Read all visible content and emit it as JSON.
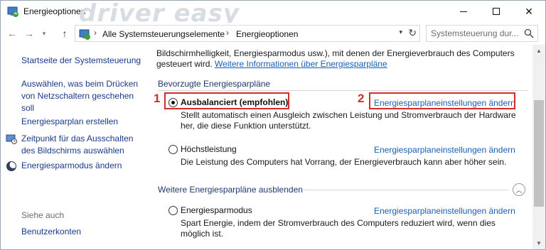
{
  "window": {
    "title": "Energieoptionen",
    "watermark": "driver easy",
    "watermark_url": "www.DriverEasy.com"
  },
  "navbar": {
    "back_glyph": "←",
    "forward_glyph": "→",
    "up_glyph": "↑",
    "breadcrumbs": [
      "Alle Systemsteuerungselemente",
      "Energieoptionen"
    ],
    "breadcrumb_separator": "›",
    "search_placeholder": "Systemsteuerung dur..."
  },
  "sidebar": {
    "home": "Startseite der Systemsteuerung",
    "link_power_buttons": "Auswählen, was beim Drücken von Netzschaltern geschehen soll",
    "link_create_plan": "Energiesparplan erstellen",
    "link_display_off": "Zeitpunkt für das Ausschalten des Bildschirms auswählen",
    "link_sleep": "Energiesparmodus ändern",
    "see_also_heading": "Siehe auch",
    "link_user_accounts": "Benutzerkonten"
  },
  "main": {
    "intro_line1": "Bildschirmhelligkeit, Energiesparmodus usw.), mit denen der Energieverbrauch des Computers",
    "intro_line2_prefix": "gesteuert wird.",
    "intro_link": "Weitere Informationen über Energiesparpläne",
    "preferred_heading": "Bevorzugte Energiesparpläne",
    "hidden_heading": "Weitere Energiesparpläne ausblenden",
    "plans": [
      {
        "name": "Ausbalanciert (empfohlen)",
        "selected": true,
        "change_link": "Energiesparplaneinstellungen ändern",
        "desc_line1": "Stellt automatisch einen Ausgleich zwischen Leistung und Stromverbrauch der Hardware",
        "desc_line2": "her, die diese Funktion unterstützt."
      },
      {
        "name": "Höchstleistung",
        "selected": false,
        "change_link": "Energiesparplaneinstellungen ändern",
        "desc_line1": "Die Leistung des Computers hat Vorrang, der Energieverbrauch kann aber höher sein."
      },
      {
        "name": "Energiesparmodus",
        "selected": false,
        "change_link": "Energiesparplaneinstellungen ändern",
        "desc_line1": "Spart Energie, indem der Stromverbrauch des Computers reduziert wird, wenn dies",
        "desc_line2": "möglich ist."
      }
    ]
  },
  "annotations": {
    "step1": "1",
    "step2": "2",
    "color": "#d62b2b"
  },
  "colors": {
    "link": "#1a5fb4",
    "sidebar_link": "#1a3a8a",
    "heading": "#1e3a6e"
  }
}
